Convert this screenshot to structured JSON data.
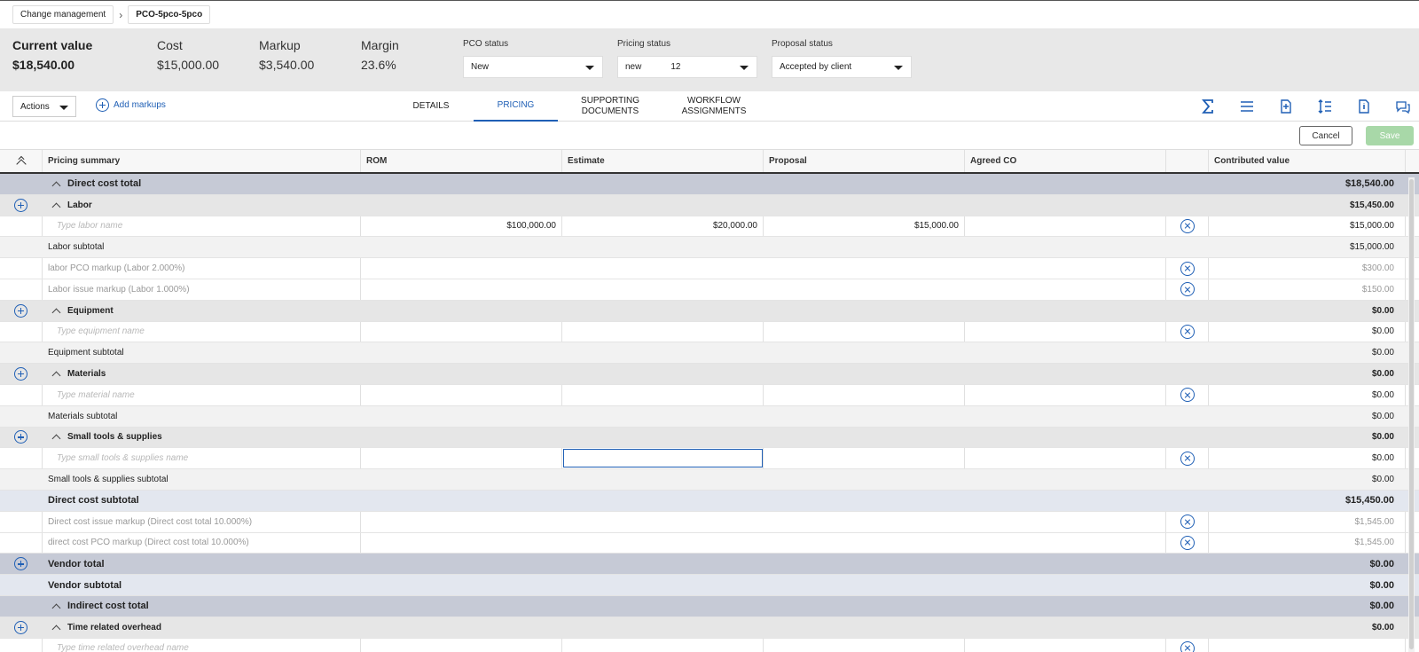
{
  "breadcrumb": {
    "parent": "Change management",
    "current": "PCO-5pco-5pco"
  },
  "summary": {
    "current_value": {
      "label": "Current value",
      "value": "$18,540.00"
    },
    "cost": {
      "label": "Cost",
      "value": "$15,000.00"
    },
    "markup": {
      "label": "Markup",
      "value": "$3,540.00"
    },
    "margin": {
      "label": "Margin",
      "value": "23.6%"
    }
  },
  "statuses": {
    "pco": {
      "label": "PCO status",
      "value": "New"
    },
    "pricing": {
      "label": "Pricing status",
      "value": "new",
      "extra": "12"
    },
    "proposal": {
      "label": "Proposal status",
      "value": "Accepted by client"
    }
  },
  "toolbar": {
    "actions_label": "Actions",
    "add_markups_label": "Add markups",
    "tabs": [
      {
        "label": "DETAILS"
      },
      {
        "label": "PRICING"
      },
      {
        "label": "SUPPORTING DOCUMENTS"
      },
      {
        "label": "WORKFLOW ASSIGNMENTS"
      }
    ],
    "icons": [
      "sum-icon",
      "list-icon",
      "add-document-icon",
      "line-height-icon",
      "document-info-icon",
      "comments-icon"
    ]
  },
  "buttons": {
    "cancel": "Cancel",
    "save": "Save"
  },
  "columns": [
    "Pricing summary",
    "ROM",
    "Estimate",
    "Proposal",
    "Agreed CO",
    "",
    "Contributed value"
  ],
  "rows": [
    {
      "label": "Direct cost total",
      "value": "$18,540.00"
    },
    {
      "label": "Labor",
      "value": "$15,450.00"
    },
    {
      "placeholder": "Type labor name",
      "rom": "$100,000.00",
      "estimate": "$20,000.00",
      "proposal": "$15,000.00",
      "value": "$15,000.00"
    },
    {
      "label": "Labor subtotal",
      "value": "$15,000.00"
    },
    {
      "label": "labor PCO markup (Labor 2.000%)",
      "value": "$300.00"
    },
    {
      "label": "Labor issue markup (Labor 1.000%)",
      "value": "$150.00"
    },
    {
      "label": "Equipment",
      "value": "$0.00"
    },
    {
      "placeholder": "Type equipment name",
      "value": "$0.00"
    },
    {
      "label": "Equipment subtotal",
      "value": "$0.00"
    },
    {
      "label": "Materials",
      "value": "$0.00"
    },
    {
      "placeholder": "Type material name",
      "value": "$0.00"
    },
    {
      "label": "Materials subtotal",
      "value": "$0.00"
    },
    {
      "label": "Small tools & supplies",
      "value": "$0.00"
    },
    {
      "placeholder": "Type small tools & supplies name",
      "value": "$0.00"
    },
    {
      "label": "Small tools & supplies subtotal",
      "value": "$0.00"
    },
    {
      "label": "Direct cost subtotal",
      "value": "$15,450.00"
    },
    {
      "label": "Direct cost issue markup (Direct cost total 10.000%)",
      "value": "$1,545.00"
    },
    {
      "label": "direct cost PCO markup (Direct cost total 10.000%)",
      "value": "$1,545.00"
    },
    {
      "label": "Vendor total",
      "value": "$0.00"
    },
    {
      "label": "Vendor subtotal",
      "value": "$0.00"
    },
    {
      "label": "Indirect cost total",
      "value": "$0.00"
    },
    {
      "label": "Time related overhead",
      "value": "$0.00"
    },
    {
      "placeholder": "Type time related overhead name"
    }
  ],
  "colors": {
    "accent": "#1f5fb5",
    "section_bg": "#c6cad6",
    "group_bg": "#e6e6e6",
    "save_disabled": "#a8d8a8"
  }
}
